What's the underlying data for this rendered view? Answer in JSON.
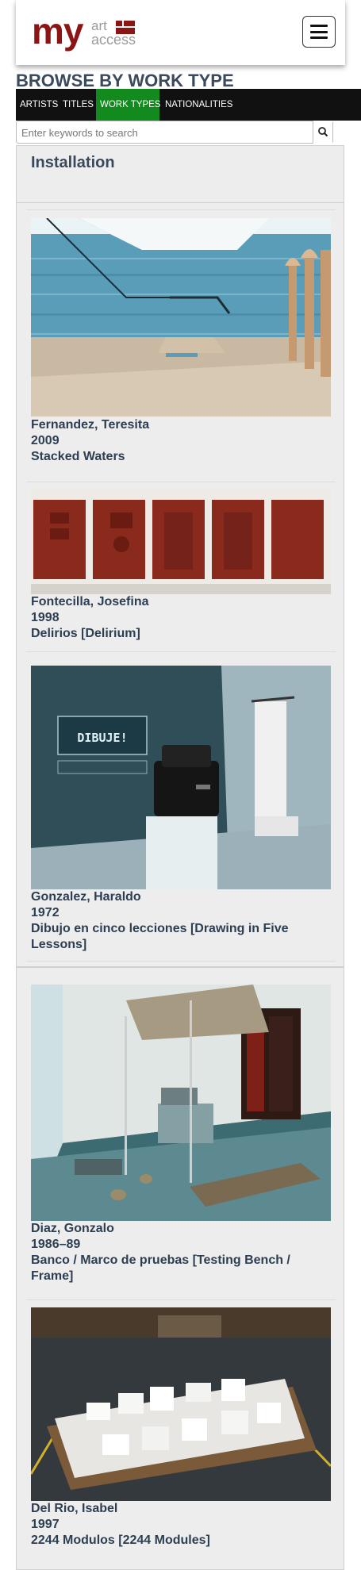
{
  "header": {
    "logo_my": "my",
    "logo_art": "art",
    "logo_access": "access",
    "brand_color": "#8b1414",
    "menu_icon": "hamburger-icon"
  },
  "page_title": "BROWSE BY WORK TYPE",
  "nav": {
    "items": [
      {
        "label": "ARTISTS",
        "active": false
      },
      {
        "label": "TITLES",
        "active": false
      },
      {
        "label": "WORK TYPES",
        "active": true
      },
      {
        "label": "NATIONALITIES",
        "active": false
      }
    ],
    "active_color": "#138a1e"
  },
  "search": {
    "placeholder": "Enter keywords to search",
    "button_icon": "search-icon"
  },
  "category": {
    "heading": "Installation"
  },
  "works": [
    {
      "artist": "Fernandez, Teresita",
      "year": "2009",
      "title": "Stacked Waters"
    },
    {
      "artist": "Fontecilla, Josefina",
      "year": "1998",
      "title": "Delirios [Delirium]"
    },
    {
      "artist": "Gonzalez, Haraldo",
      "year": "1972",
      "title": "Dibujo en cinco lecciones [Drawing in Five Lessons]",
      "image_text": "DIBUJE!"
    },
    {
      "artist": "Diaz, Gonzalo",
      "year": "1986–89",
      "title": "Banco / Marco de pruebas [Testing Bench / Frame]"
    },
    {
      "artist": "Del Rio, Isabel",
      "year": "1997",
      "title": "2244 Modulos [2244 Modules]"
    }
  ]
}
